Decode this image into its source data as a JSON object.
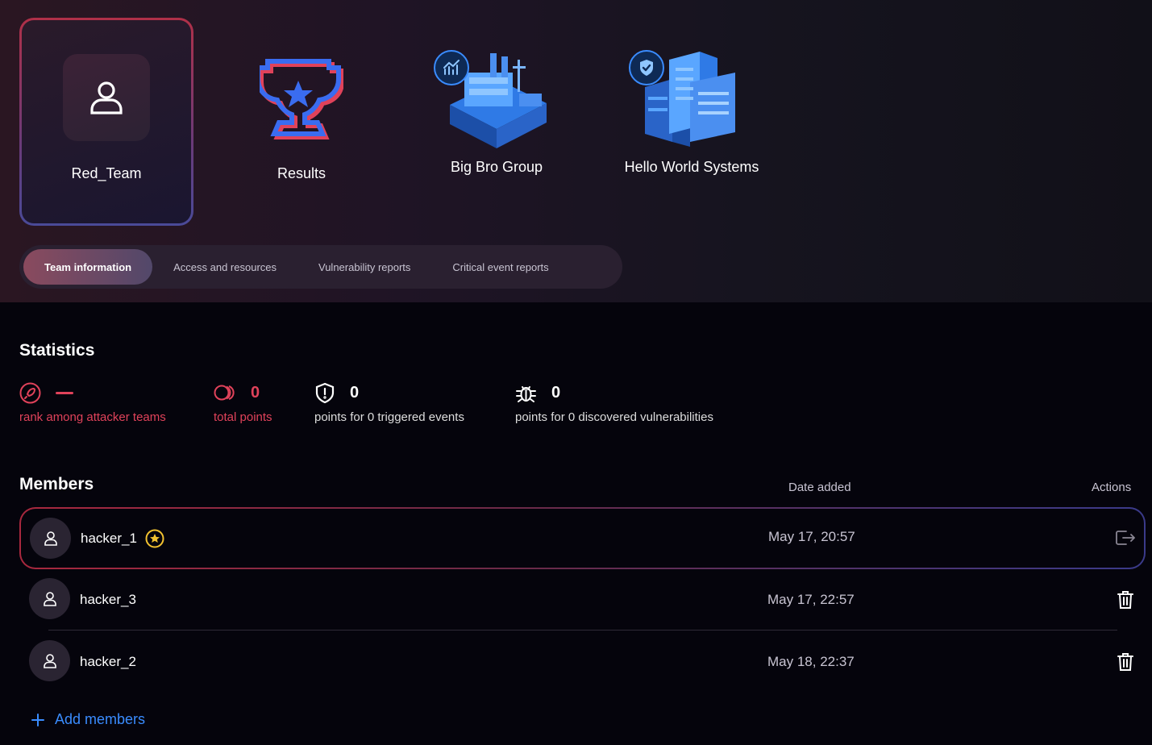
{
  "cards": [
    {
      "label": "Red_Team",
      "icon": "user-icon",
      "selected": true
    },
    {
      "label": "Results",
      "icon": "trophy-icon"
    },
    {
      "label": "Big Bro Group",
      "icon": "factory-icon",
      "badge": "chart-icon"
    },
    {
      "label": "Hello World Systems",
      "icon": "office-buildings-icon",
      "badge": "shield-check-icon"
    }
  ],
  "tabs": [
    {
      "label": "Team information",
      "active": true
    },
    {
      "label": "Access and resources"
    },
    {
      "label": "Vulnerability reports"
    },
    {
      "label": "Critical event reports"
    }
  ],
  "statistics": {
    "title": "Statistics",
    "items": [
      {
        "icon": "rocket-icon",
        "value": "—",
        "caption": "rank among attacker teams",
        "color": "#e0425a"
      },
      {
        "icon": "coins-icon",
        "value": "0",
        "caption": "total points",
        "color": "#e0425a"
      },
      {
        "icon": "shield-alert-icon",
        "value": "0",
        "caption": "points for 0 triggered events",
        "color": "#ffffff"
      },
      {
        "icon": "bug-icon",
        "value": "0",
        "caption": "points for 0 discovered vulnerabilities",
        "color": "#ffffff"
      }
    ]
  },
  "members": {
    "title": "Members",
    "col_date": "Date added",
    "col_actions": "Actions",
    "rows": [
      {
        "name": "hacker_1",
        "captain": true,
        "date": "May 17, 20:57",
        "action": "leave-icon"
      },
      {
        "name": "hacker_3",
        "date": "May 17, 22:57",
        "action": "trash-icon"
      },
      {
        "name": "hacker_2",
        "date": "May 18, 22:37",
        "action": "trash-icon"
      }
    ],
    "add_label": "Add members"
  },
  "colors": {
    "accent_red": "#e0425a",
    "accent_blue": "#3a8cff",
    "background": "#05040c"
  }
}
